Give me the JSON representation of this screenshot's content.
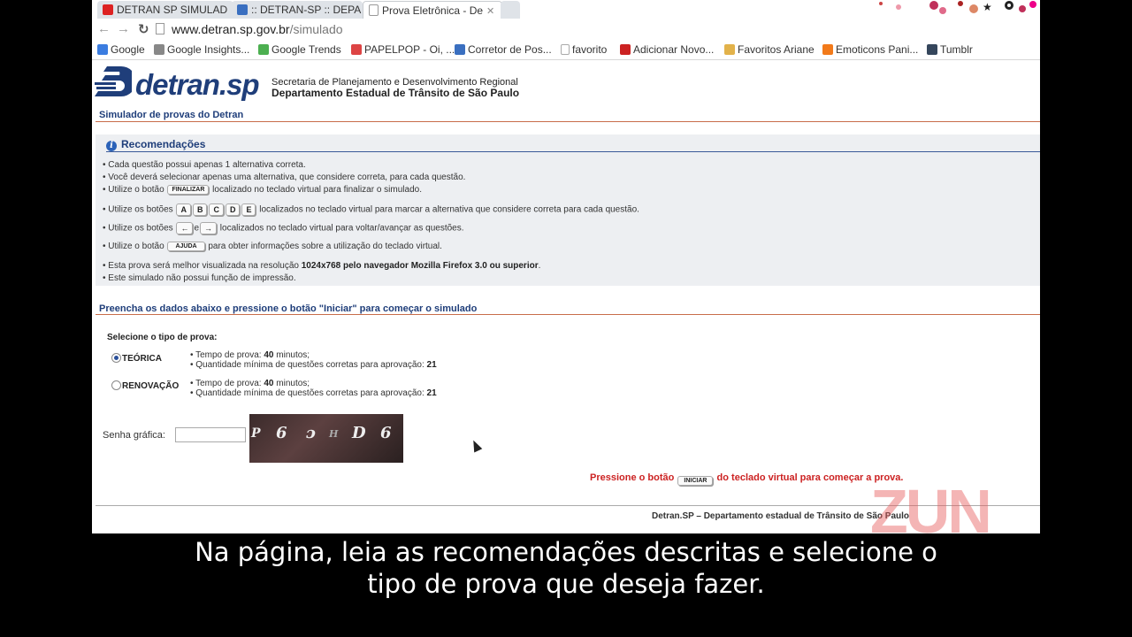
{
  "browser": {
    "tabs": [
      {
        "label": "DETRAN SP SIMULAD",
        "state": "inactive",
        "favicon_color": "#d22"
      },
      {
        "label": ":: DETRAN-SP :: DEPA",
        "state": "inactive",
        "favicon_color": "#3a6fc0"
      },
      {
        "label": "Prova Eletrônica - De",
        "state": "active",
        "favicon_color": "#ffffff"
      }
    ],
    "address": {
      "host": "www.detran.sp.gov.br",
      "path": "/simulado"
    },
    "bookmarks": [
      {
        "label": "Google",
        "icon": "google-icon",
        "color": "#3b7de0"
      },
      {
        "label": "Google Insights...",
        "icon": "insights-icon",
        "color": "#888888"
      },
      {
        "label": "Google Trends",
        "icon": "trends-icon",
        "color": "#4caf50"
      },
      {
        "label": "PAPELPOP - Oi, ...",
        "icon": "papelpop-icon",
        "color": "#d44"
      },
      {
        "label": "Corretor de Pos...",
        "icon": "corretor-icon",
        "color": "#3a6fc0"
      },
      {
        "label": "favorito",
        "icon": "page-icon",
        "color": "#bbbbbb"
      },
      {
        "label": "Adicionar Novo...",
        "icon": "zotero-icon",
        "color": "#c22"
      },
      {
        "label": "Favoritos Ariane",
        "icon": "folder-icon",
        "color": "#e2b24a"
      },
      {
        "label": "Emoticons Pani...",
        "icon": "blogger-icon",
        "color": "#f27a1a"
      },
      {
        "label": "Tumblr",
        "icon": "tumblr-icon",
        "color": "#35465c"
      }
    ]
  },
  "header": {
    "logo_text": "detran.sp",
    "dept_line1": "Secretaria de Planejamento e Desenvolvimento Regional",
    "dept_line2": "Departamento Estadual de Trânsito de São Paulo"
  },
  "section_title": "Simulador de provas do Detran",
  "recommendations": {
    "heading": "Recomendações",
    "line1": "Cada questão possui apenas 1 alternativa correta.",
    "line2": "Você deverá selecionar apenas uma alternativa, que considere correta, para cada questão.",
    "line3_pre": "Utilize o botão",
    "line3_key": "FINALIZAR",
    "line3_post": "localizado no teclado virtual para finalizar o simulado.",
    "line4_pre": "Utilize os botões",
    "line4_keys": [
      "A",
      "B",
      "C",
      "D",
      "E"
    ],
    "line4_post": "localizados no teclado virtual para marcar a alternativa que considere correta para cada questão.",
    "line5_pre": "Utilize os botões",
    "line5_key1": "←",
    "line5_mid": "e",
    "line5_key2": "→",
    "line5_post": "localizados no teclado virtual para voltar/avançar as questões.",
    "line6_pre": "Utilize o botão",
    "line6_key": "AJUDA",
    "line6_post": "para obter informações sobre a utilização do teclado virtual.",
    "line7_pre": "Esta prova será melhor visualizada na resolução",
    "line7_bold": "1024x768 pelo navegador Mozilla Firefox 3.0 ou superior",
    "line7_post": ".",
    "line8": "Este simulado não possui função de impressão."
  },
  "form": {
    "title": "Preencha os dados abaixo e pressione o botão \"Iniciar\" para começar o simulado",
    "select_label": "Selecione o tipo de prova:",
    "options": [
      {
        "label": "TEÓRICA",
        "selected": true,
        "time_pre": "• Tempo de prova: ",
        "time_value": "40",
        "time_post": " minutos;",
        "min_pre": "• Quantidade mínima de questões corretas para aprovação: ",
        "min_value": "21"
      },
      {
        "label": "RENOVAÇÃO",
        "selected": false,
        "time_pre": "• Tempo de prova: ",
        "time_value": "40",
        "time_post": " minutos;",
        "min_pre": "• Quantidade mínima de questões corretas para aprovação: ",
        "min_value": "21"
      }
    ],
    "senha_label": "Senha gráfica:",
    "senha_value": "",
    "captcha_chars": [
      "P",
      "6",
      "ɔ",
      "H",
      "D",
      "6"
    ],
    "press_pre": "Pressione o botão",
    "press_key": "INICIAR",
    "press_post": "do teclado virtual para começar a prova."
  },
  "footer": "Detran.SP – Departamento estadual de Trânsito de São Paulo",
  "watermark": "ZUN",
  "subtitle": {
    "line1": "Na página, leia as recomendações descritas e selecione o",
    "line2": "tipo de prova que deseja fazer."
  }
}
